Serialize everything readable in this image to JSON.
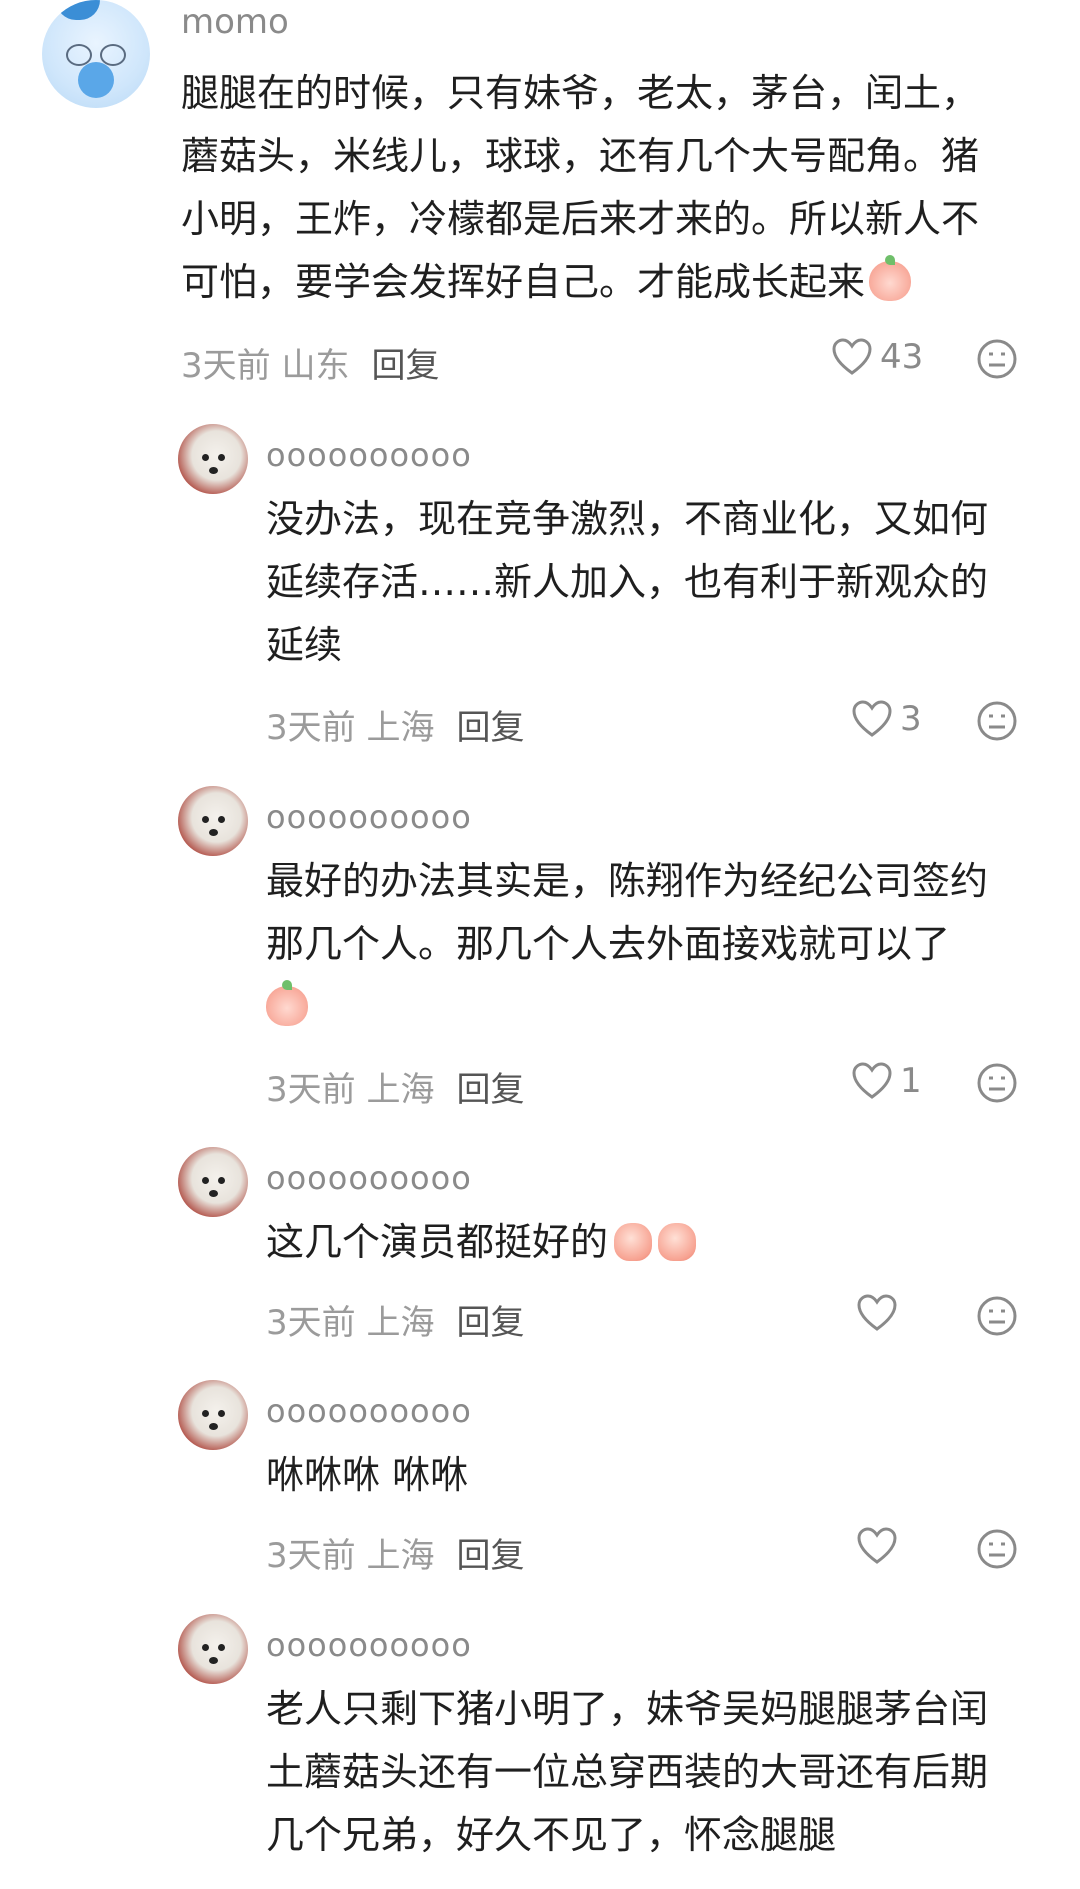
{
  "top_comment": {
    "username": "momo",
    "lines": [
      "腿腿在的时候，只有妹爷，老太，茅台，闰土，",
      "蘑菇头，米线儿，球球，还有几个大号配角。猪",
      "小明，王炸，冷檬都是后来才来的。所以新人不",
      "可怕，要学会发挥好自己。才能成长起来"
    ],
    "time_location": "3天前 山东",
    "reply_label": "回复",
    "likes": "43"
  },
  "replies": [
    {
      "username": "oooooooooo",
      "lines": [
        "没办法，现在竞争激烈，不商业化，又如何",
        "延续存活……新人加入，也有利于新观众的",
        "延续"
      ],
      "time_location": "3天前 上海",
      "reply_label": "回复",
      "likes": "3"
    },
    {
      "username": "oooooooooo",
      "lines": [
        "最好的办法其实是，陈翔作为经纪公司签约",
        "那几个人。那几个人去外面接戏就可以了"
      ],
      "time_location": "3天前 上海",
      "reply_label": "回复",
      "likes": "1"
    },
    {
      "username": "oooooooooo",
      "lines": [
        "这几个演员都挺好的"
      ],
      "time_location": "3天前 上海",
      "reply_label": "回复",
      "likes": ""
    },
    {
      "username": "oooooooooo",
      "lines": [
        "咻咻咻 咻咻"
      ],
      "time_location": "3天前 上海",
      "reply_label": "回复",
      "likes": ""
    },
    {
      "username": "oooooooooo",
      "lines": [
        "老人只剩下猪小明了，妹爷吴妈腿腿茅台闰",
        "土蘑菇头还有一位总穿西装的大哥还有后期",
        "几个兄弟，好久不见了，怀念腿腿"
      ]
    }
  ],
  "icons": {
    "like": "heart-outline-icon",
    "face": "neutral-face-icon",
    "emoji_peach": "peach-smile-emoji",
    "emoji_thumb": "thumbs-up-emoji"
  }
}
